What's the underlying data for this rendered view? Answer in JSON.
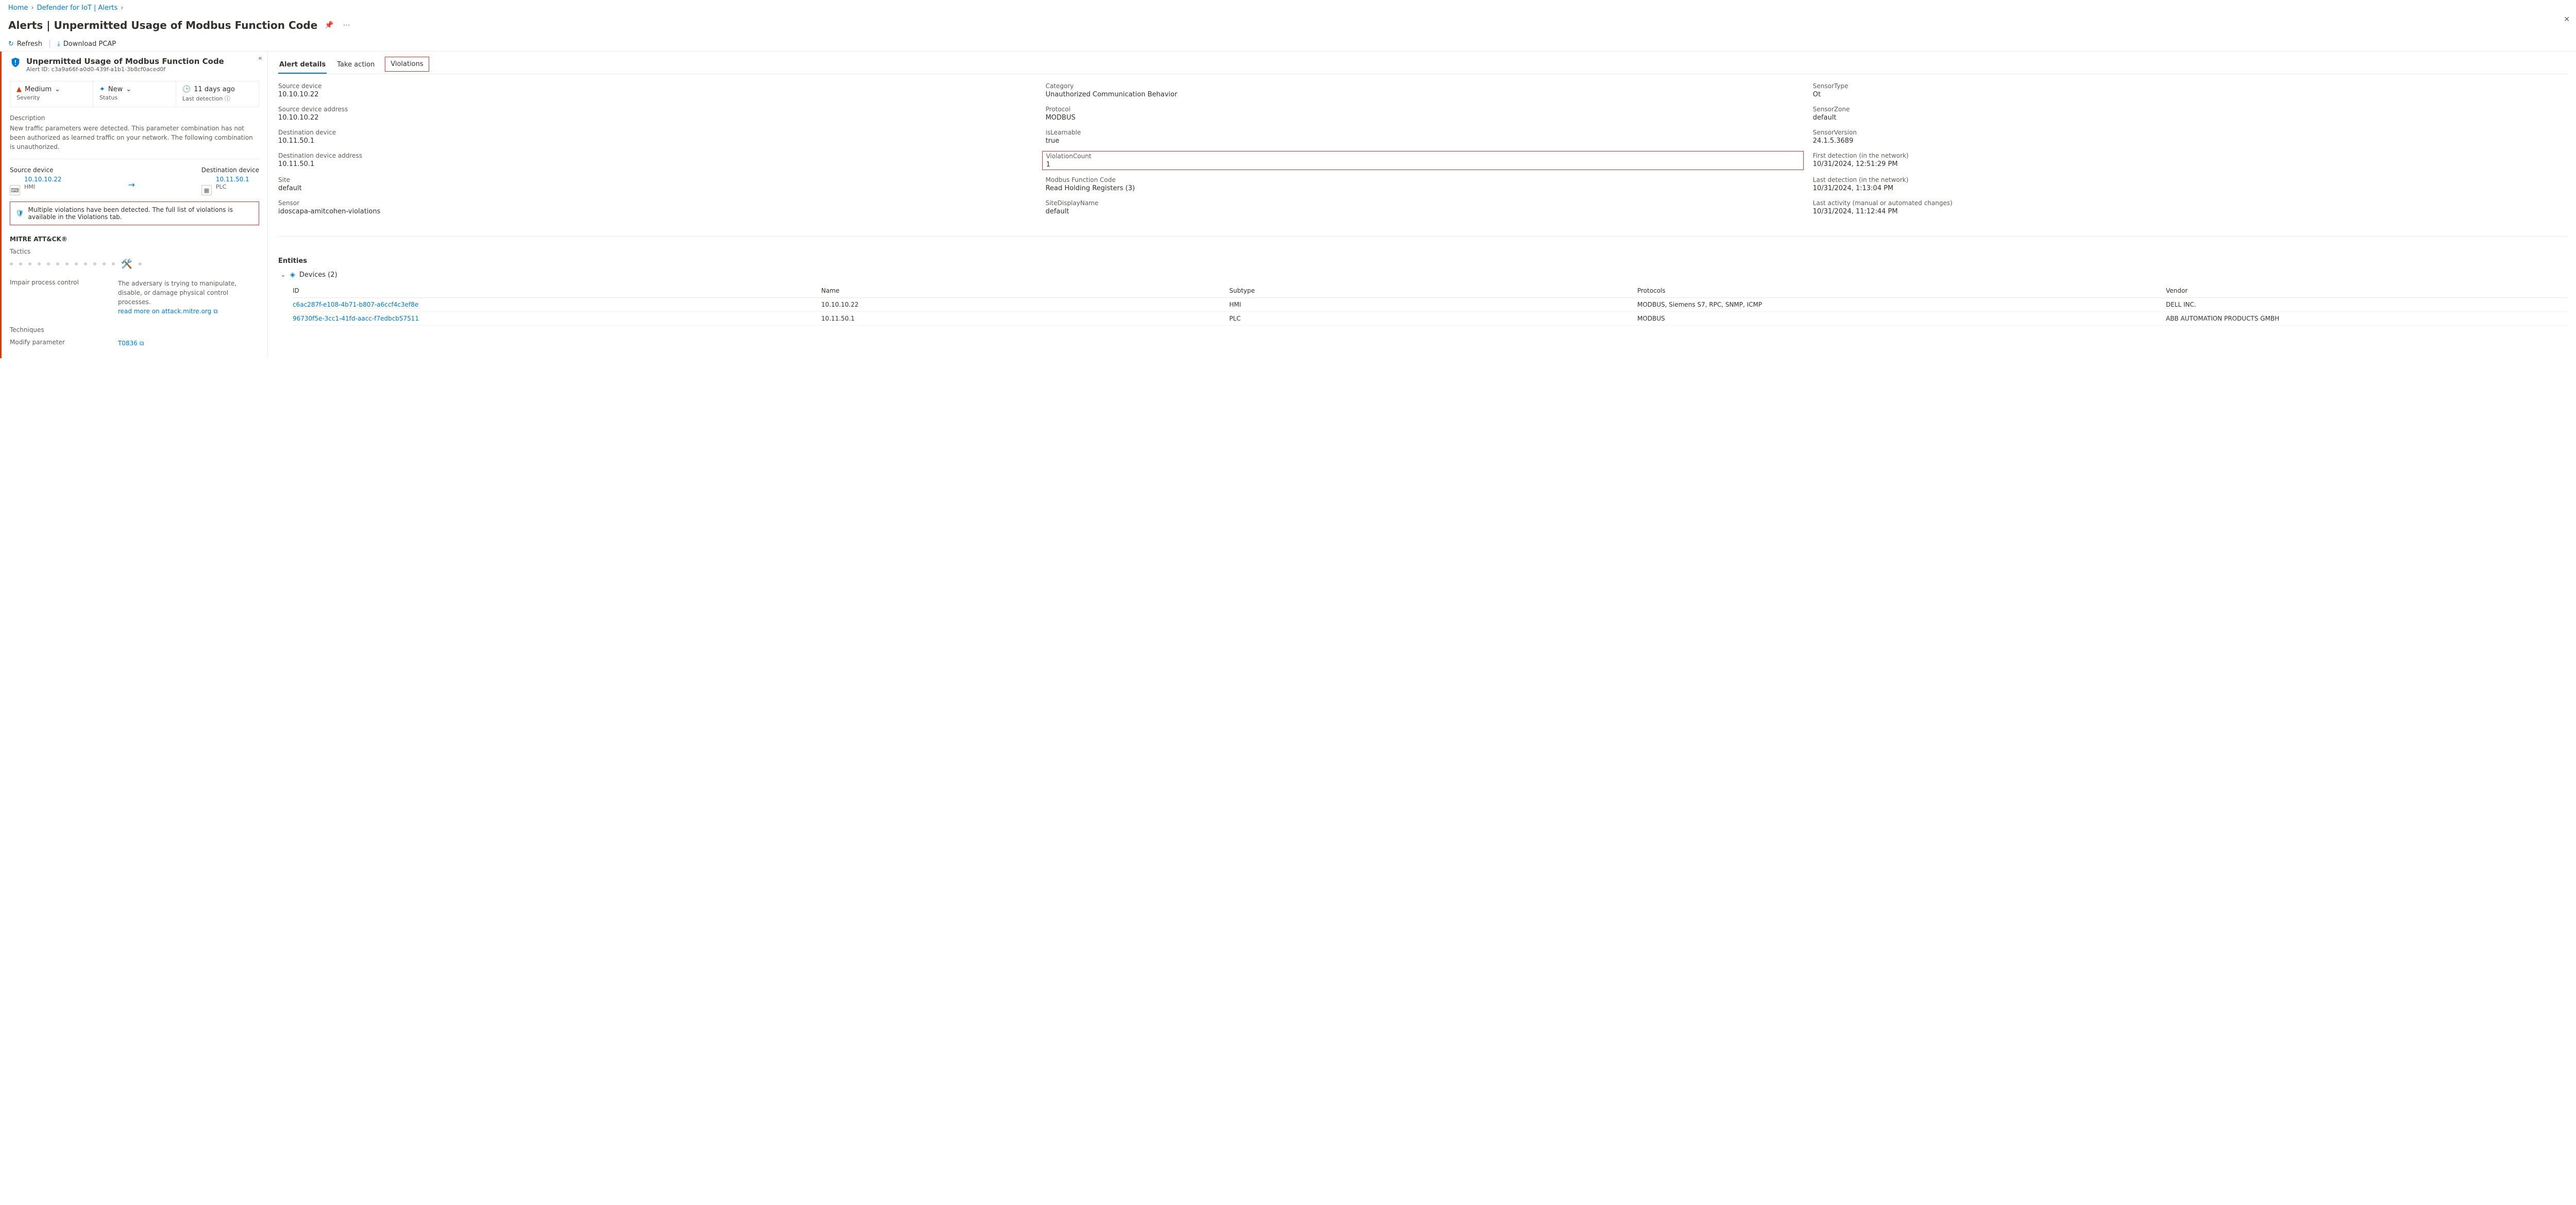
{
  "breadcrumb": {
    "home": "Home",
    "d4iot": "Defender for IoT | Alerts"
  },
  "page": {
    "title": "Alerts | Unpermitted Usage of Modbus Function Code"
  },
  "cmd": {
    "refresh": "Refresh",
    "pcap": "Download PCAP"
  },
  "alert": {
    "title": "Unpermitted Usage of Modbus Function Code",
    "id_label": "Alert ID:",
    "id": "c3a9a66f-a0d0-439f-a1b1-3b8cf0aced0f",
    "severity": {
      "value": "Medium",
      "label": "Severity"
    },
    "status": {
      "value": "New",
      "label": "Status"
    },
    "last": {
      "value": "11 days ago",
      "label": "Last detection"
    },
    "desc_label": "Description",
    "desc": "New traffic parameters were detected. This parameter combination has not been authorized as learned traffic on your network. The following combination is unauthorized.",
    "src": {
      "label": "Source device",
      "ip": "10.10.10.22",
      "type": "HMI"
    },
    "dst": {
      "label": "Destination device",
      "ip": "10.11.50.1",
      "type": "PLC"
    },
    "info": "Multiple violations have been detected. The full list of violations is available in the Violations tab."
  },
  "mitre": {
    "head": "MITRE ATT&CK®",
    "tactics_label": "Tactics",
    "tactic_name": "Impair process control",
    "tactic_desc": "The adversary is trying to manipulate, disable, or damage physical control processes.",
    "read_more": "read more on attack.mitre.org",
    "tech_label": "Techniques",
    "tech_name": "Modify parameter",
    "tech_id": "T0836"
  },
  "tabs": {
    "details": "Alert details",
    "take": "Take action",
    "violations": "Violations"
  },
  "details": {
    "src_dev": {
      "k": "Source device",
      "v": "10.10.10.22"
    },
    "src_addr": {
      "k": "Source device address",
      "v": "10.10.10.22"
    },
    "dst_dev": {
      "k": "Destination device",
      "v": "10.11.50.1"
    },
    "dst_addr": {
      "k": "Destination device address",
      "v": "10.11.50.1"
    },
    "site": {
      "k": "Site",
      "v": "default"
    },
    "sensor": {
      "k": "Sensor",
      "v": "idoscapa-amitcohen-violations"
    },
    "category": {
      "k": "Category",
      "v": "Unauthorized Communication Behavior"
    },
    "protocol": {
      "k": "Protocol",
      "v": "MODBUS"
    },
    "learn": {
      "k": "isLearnable",
      "v": "true"
    },
    "vcount": {
      "k": "ViolationCount",
      "v": "1"
    },
    "func": {
      "k": "Modbus Function Code",
      "v": "Read Holding Registers (3)"
    },
    "sdn": {
      "k": "SiteDisplayName",
      "v": "default"
    },
    "stype": {
      "k": "SensorType",
      "v": "Ot"
    },
    "szone": {
      "k": "SensorZone",
      "v": "default"
    },
    "sver": {
      "k": "SensorVersion",
      "v": "24.1.5.3689"
    },
    "first": {
      "k": "First detection (in the network)",
      "v": "10/31/2024, 12:51:29 PM"
    },
    "lastnet": {
      "k": "Last detection (in the network)",
      "v": "10/31/2024, 1:13:04 PM"
    },
    "lastact": {
      "k": "Last activity (manual or automated changes)",
      "v": "10/31/2024, 11:12:44 PM"
    }
  },
  "entities": {
    "head": "Entities",
    "devices_label": "Devices (2)",
    "cols": {
      "id": "ID",
      "name": "Name",
      "subtype": "Subtype",
      "protocols": "Protocols",
      "vendor": "Vendor"
    },
    "rows": [
      {
        "id": "c6ac287f-e108-4b71-b807-a6ccf4c3ef8e",
        "name": "10.10.10.22",
        "subtype": "HMI",
        "protocols": "MODBUS, Siemens S7, RPC, SNMP, ICMP",
        "vendor": "DELL INC."
      },
      {
        "id": "96730f5e-3cc1-41fd-aacc-f7edbcb57511",
        "name": "10.11.50.1",
        "subtype": "PLC",
        "protocols": "MODBUS",
        "vendor": "ABB AUTOMATION PRODUCTS GMBH"
      }
    ]
  }
}
